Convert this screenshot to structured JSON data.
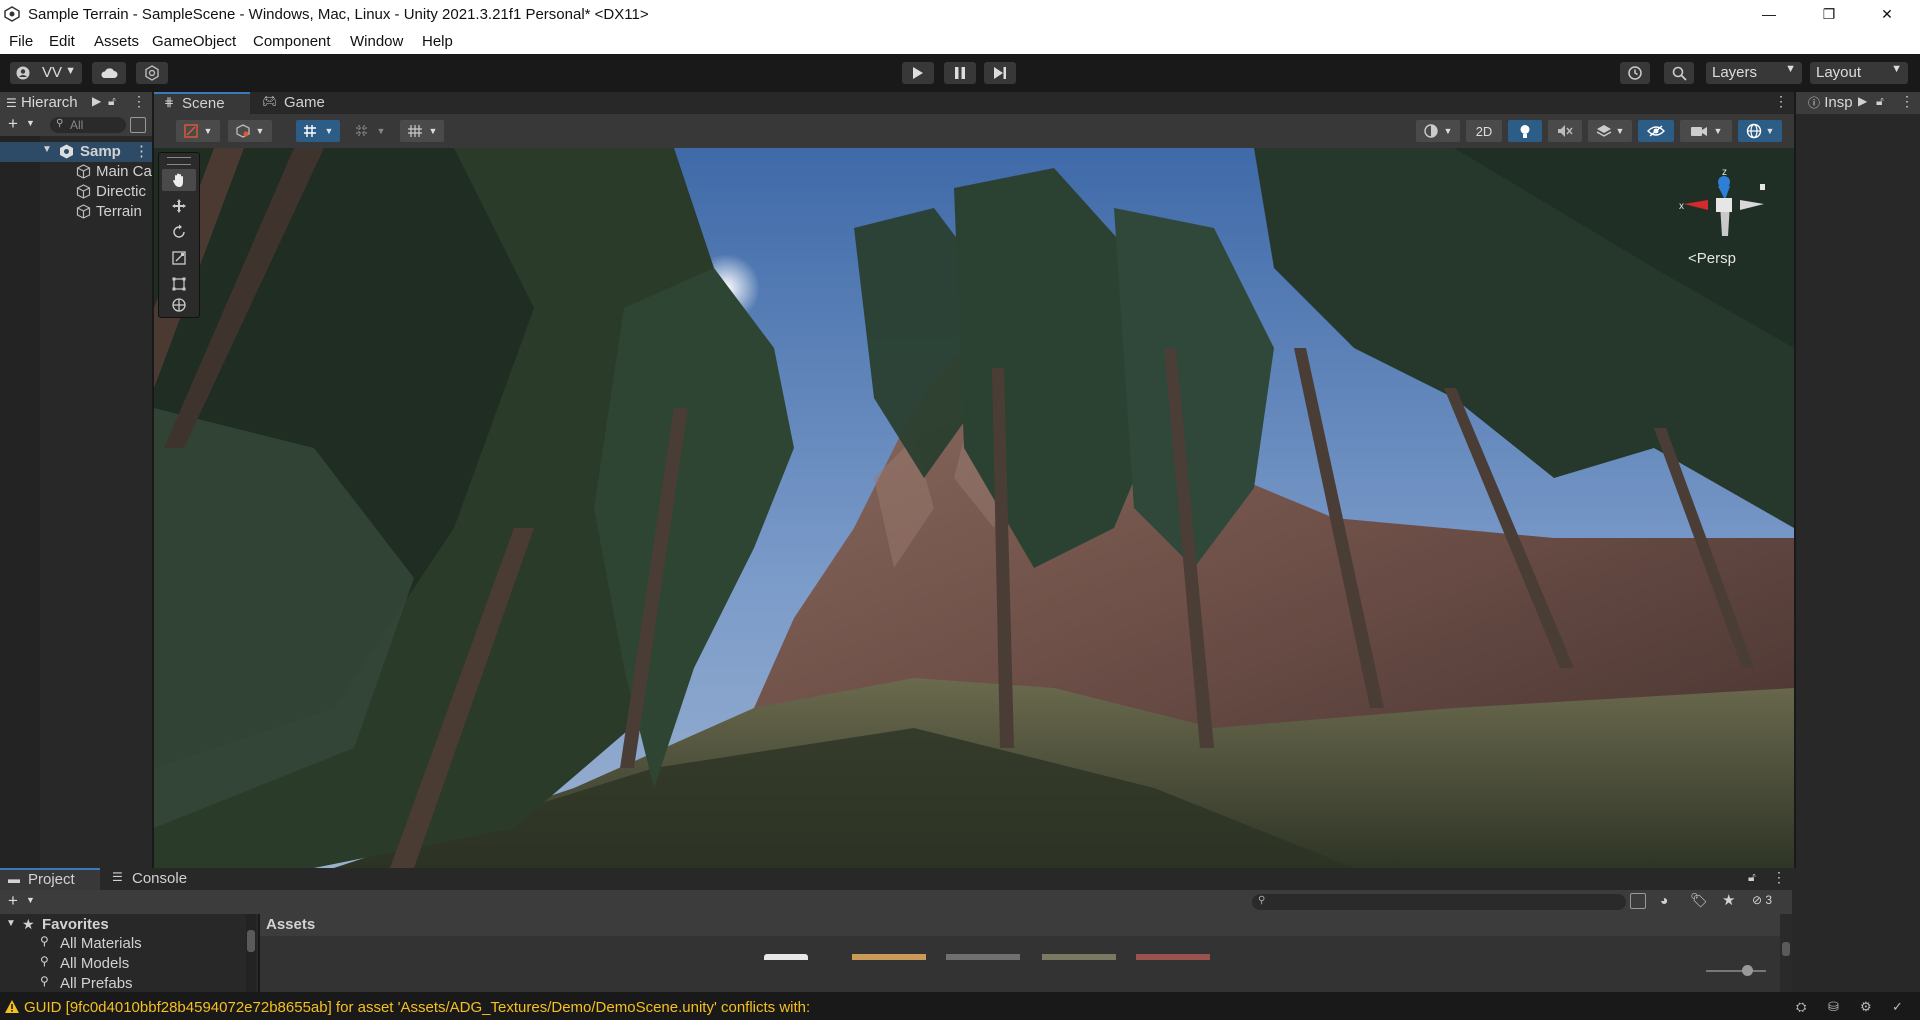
{
  "titlebar": {
    "title": "Sample Terrain - SampleScene - Windows, Mac, Linux - Unity 2021.3.21f1 Personal* <DX11>",
    "min_symbol": "—",
    "max_symbol": "❐",
    "close_symbol": "✕"
  },
  "menu": [
    "File",
    "Edit",
    "Assets",
    "GameObject",
    "Component",
    "Window",
    "Help"
  ],
  "toolbar": {
    "account_label": "VV",
    "layers_label": "Layers",
    "layout_label": "Layout"
  },
  "hierarchy": {
    "tab_label": "Hierarch",
    "search_placeholder": "All",
    "scene_name": "Samp",
    "items": [
      "Main Ca",
      "Directic",
      "Terrain"
    ]
  },
  "scene": {
    "tabs": [
      "Scene",
      "Game"
    ],
    "toolbar_2d_label": "2D",
    "persp_label": "Persp",
    "gizmo_x": "x",
    "gizmo_z": "z"
  },
  "inspector": {
    "tab_label": "Insp"
  },
  "project": {
    "tabs": [
      "Project",
      "Console"
    ],
    "favorites_label": "Favorites",
    "favorites": [
      "All Materials",
      "All Models",
      "All Prefabs"
    ],
    "assets_label": "Assets",
    "hidden_count": "3"
  },
  "status": {
    "message": "GUID [9fc0d4010bbf28b4594072e72b8655ab] for asset 'Assets/ADG_Textures/Demo/DemoScene.unity' conflicts with:"
  },
  "colors": {
    "accent_blue": "#2c5d87",
    "warning_yellow": "#f4c020",
    "sky": "#7390c0"
  }
}
